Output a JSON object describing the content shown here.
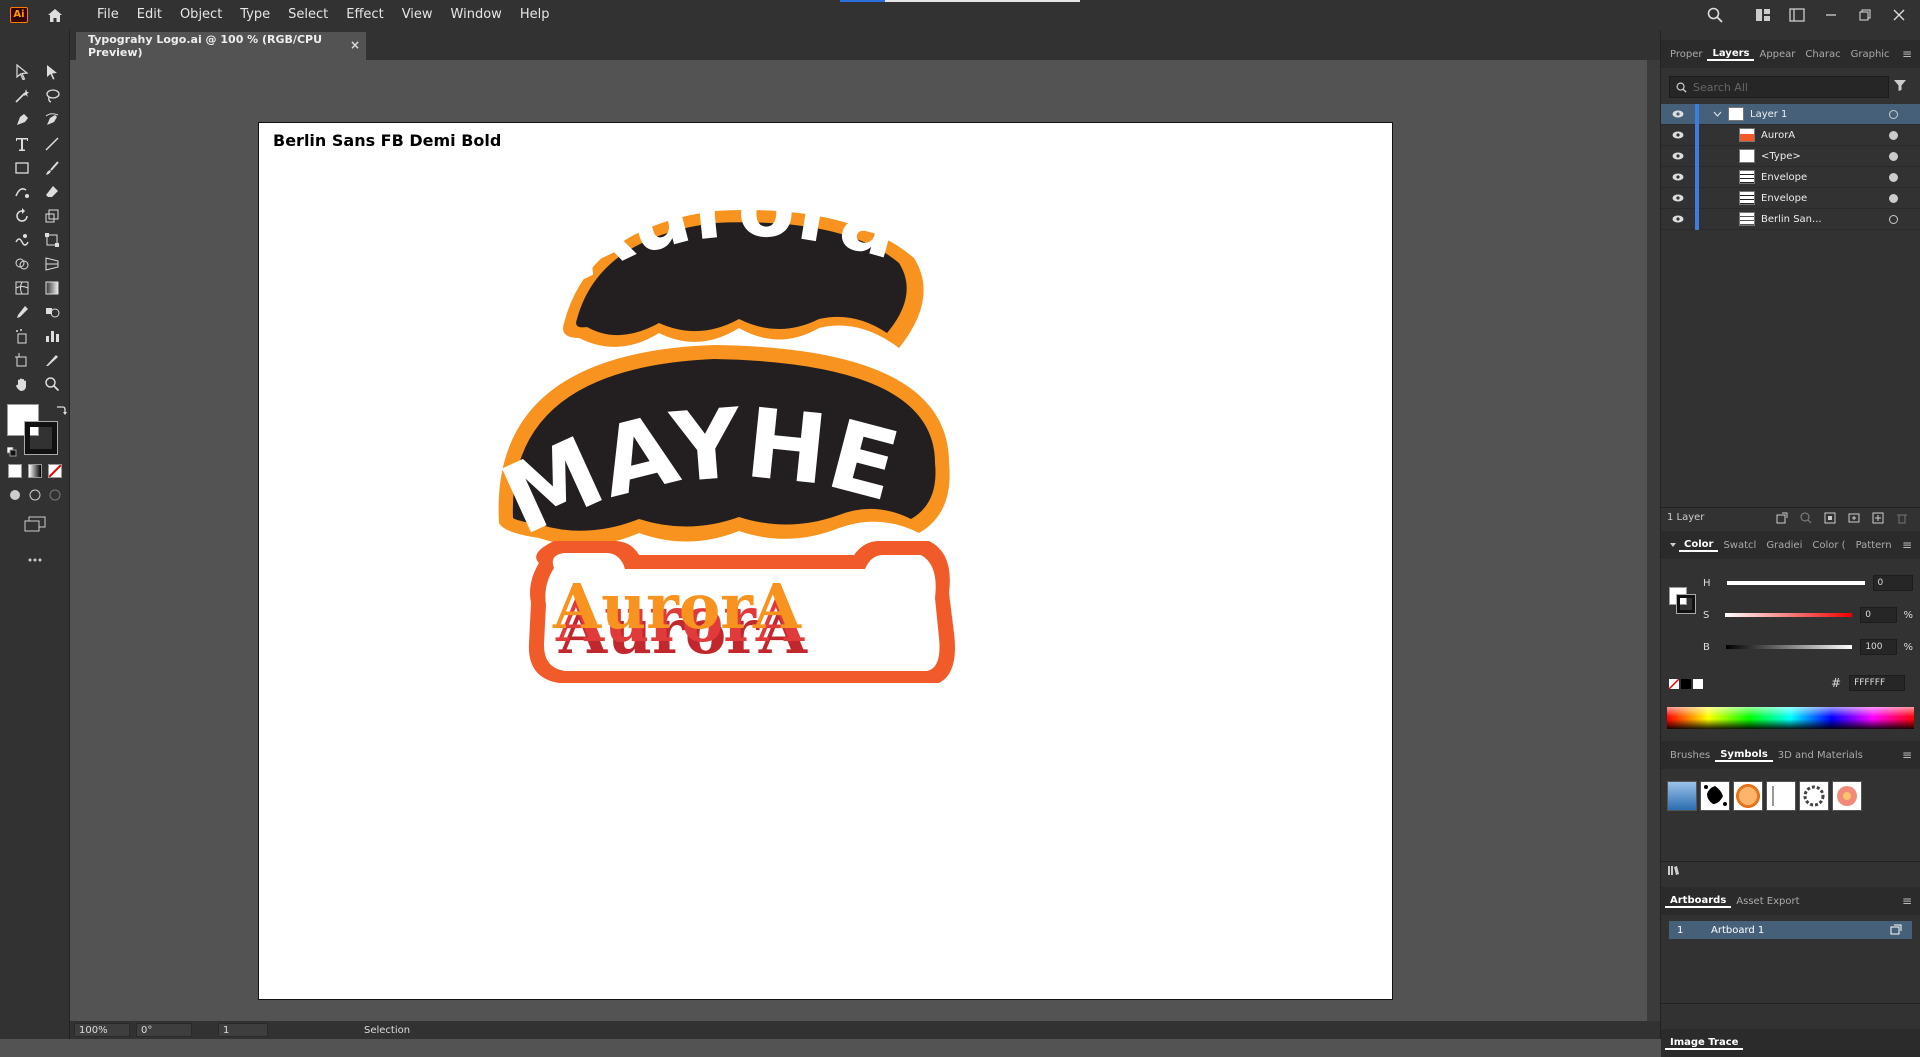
{
  "menubar": {
    "app_icon": "Ai",
    "menus": [
      "File",
      "Edit",
      "Object",
      "Type",
      "Select",
      "Effect",
      "View",
      "Window",
      "Help"
    ]
  },
  "document": {
    "tab_title": "Typograhy Logo.ai @ 100 % (RGB/CPU Preview)",
    "close_glyph": "×"
  },
  "artboard": {
    "font_label": "Berlin Sans FB Demi Bold",
    "logos": {
      "aurora_arc": "Aurora",
      "mayhem": "MAYHEM",
      "aurora_slab": "AurorA"
    },
    "colors": {
      "orange_outline": "#F7931E",
      "dark_fill": "#231F20",
      "red_outline": "#F15A29",
      "orange_text": "#F7931E",
      "red_shadow": "#E03A3A",
      "dark_red_shadow": "#C1272D"
    }
  },
  "statusbar": {
    "zoom": "100%",
    "rotation": "0°",
    "artboard_number": "1",
    "tool": "Selection"
  },
  "panels": {
    "top_tabs": [
      "Proper",
      "Layers",
      "Appear",
      "Charac",
      "Graphic"
    ],
    "layers": {
      "search_placeholder": "Search All",
      "rows": [
        {
          "name": "Layer 1"
        },
        {
          "name": "AurorA"
        },
        {
          "name": "<Type>"
        },
        {
          "name": "Envelope"
        },
        {
          "name": "Envelope"
        },
        {
          "name": "Berlin San..."
        }
      ],
      "footer": "1 Layer"
    },
    "color": {
      "tabs": [
        "Color",
        "Swatcl",
        "Gradiei",
        "Color (",
        "Pattern"
      ],
      "h_label": "H",
      "s_label": "S",
      "b_label": "B",
      "h_value": "0",
      "s_value": "0",
      "b_value": "100",
      "s_unit": "%",
      "b_unit": "%",
      "hex_hash": "#",
      "hex_value": "FFFFFF"
    },
    "symbols": {
      "tabs": [
        "Brushes",
        "Symbols",
        "3D and Materials"
      ]
    },
    "artboards": {
      "tabs": [
        "Artboards",
        "Asset Export"
      ],
      "rows": [
        {
          "number": "1",
          "name": "Artboard 1"
        }
      ]
    },
    "image_trace": "Image Trace"
  }
}
